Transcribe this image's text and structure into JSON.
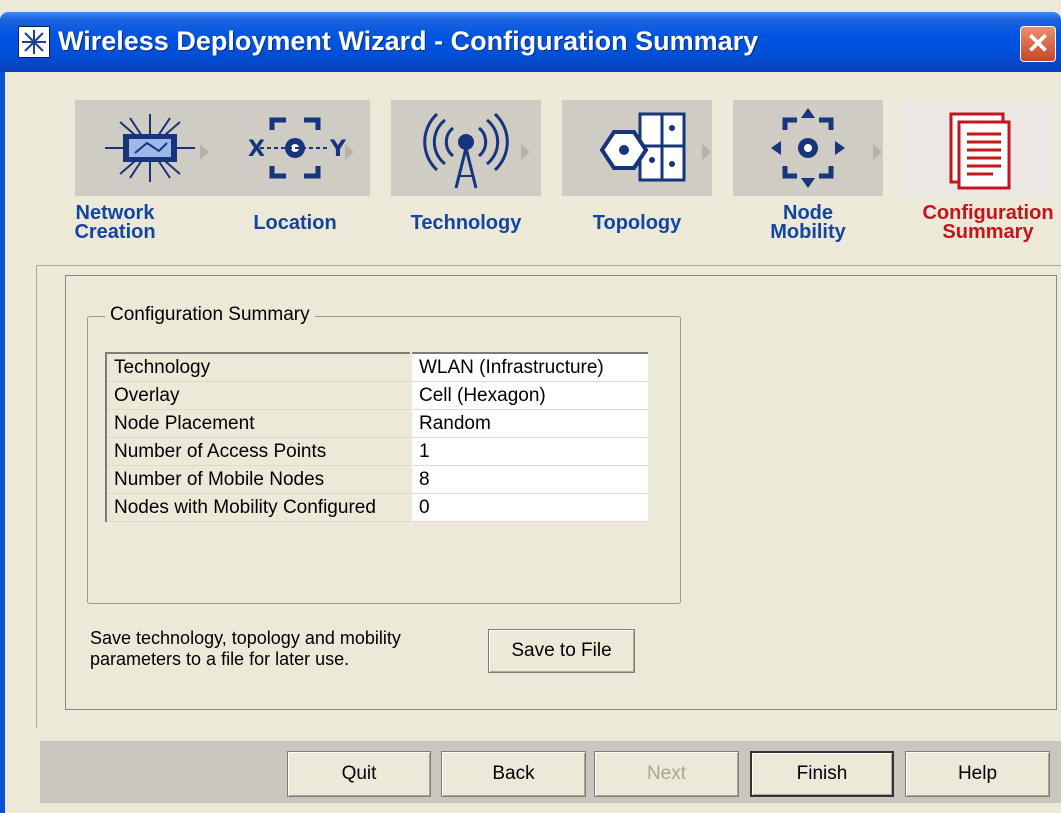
{
  "window": {
    "title": "Wireless Deployment Wizard - Configuration Summary",
    "close_label": "✕"
  },
  "steps": [
    {
      "line1": "Network",
      "line2": "Creation",
      "icon": "network-icon",
      "active": false
    },
    {
      "line1": "Location",
      "line2": "",
      "icon": "location-icon",
      "active": false
    },
    {
      "line1": "Technology",
      "line2": "",
      "icon": "antenna-icon",
      "active": false
    },
    {
      "line1": "Topology",
      "line2": "",
      "icon": "topology-icon",
      "active": false
    },
    {
      "line1": "Node",
      "line2": "Mobility",
      "icon": "mobility-icon",
      "active": false
    },
    {
      "line1": "Configuration",
      "line2": "Summary",
      "icon": "document-icon",
      "active": true
    }
  ],
  "summary": {
    "group_title": "Configuration Summary",
    "rows": [
      {
        "key": "Technology",
        "value": "WLAN (Infrastructure)"
      },
      {
        "key": "Overlay",
        "value": "Cell (Hexagon)"
      },
      {
        "key": "Node Placement",
        "value": "Random"
      },
      {
        "key": "Number of Access Points",
        "value": "1"
      },
      {
        "key": "Number of Mobile Nodes",
        "value": "8"
      },
      {
        "key": "Nodes with Mobility Configured",
        "value": "0"
      }
    ]
  },
  "save": {
    "text_line1": "Save technology, topology and mobility",
    "text_line2": "parameters to a file for later use.",
    "button_label": "Save to File"
  },
  "buttons": {
    "quit": "Quit",
    "back": "Back",
    "next": "Next",
    "finish": "Finish",
    "help": "Help"
  },
  "colors": {
    "titlebar": "#0054e3",
    "step_label": "#13459f",
    "active_step_label": "#c4141c"
  }
}
